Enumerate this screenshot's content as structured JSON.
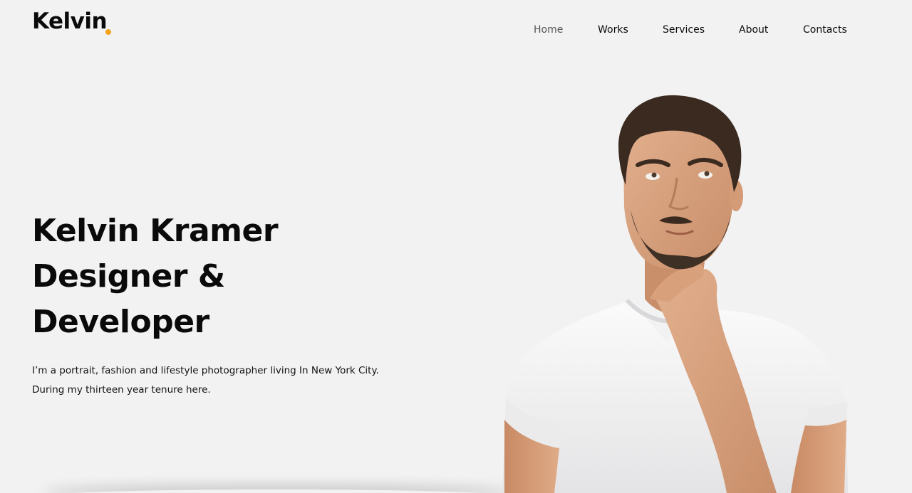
{
  "brand": {
    "logo_text": "Kelvin",
    "dot_color": "#f5a31a"
  },
  "nav": {
    "items": [
      {
        "label": "Home",
        "active": true
      },
      {
        "label": "Works",
        "active": false
      },
      {
        "label": "Services",
        "active": false
      },
      {
        "label": "About",
        "active": false
      },
      {
        "label": "Contacts",
        "active": false
      }
    ]
  },
  "hero": {
    "title_lines": [
      "Kelvin Kramer",
      "Designer &",
      "Developer"
    ],
    "description_lines": [
      "I’m a portrait, fashion and lifestyle photographer living In New York City.",
      "During my thirteen year tenure here."
    ],
    "portrait_icon": "person-portrait-icon"
  },
  "colors": {
    "background": "#f2f2f2",
    "text": "#0a0a0a",
    "accent": "#f5a31a"
  }
}
